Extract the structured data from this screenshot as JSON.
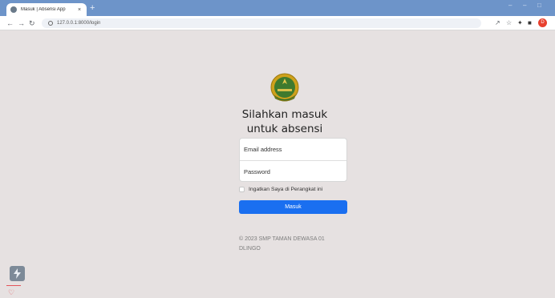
{
  "browser": {
    "tab_title": "Masuk | Absensi App",
    "tab_close": "×",
    "new_tab": "+",
    "url": "127.0.0.1:8000/login",
    "profile_initial": "D"
  },
  "login": {
    "heading_line1": "Silahkan masuk",
    "heading_line2": "untuk absensi",
    "email_placeholder": "Email address",
    "password_placeholder": "Password",
    "remember_label": "Ingatkan Saya di Perangkat ini",
    "submit_label": "Masuk",
    "footer_line1": "© 2023 SMP TAMAN DEWASA 01",
    "footer_line2": "DLINGO"
  },
  "colors": {
    "page_bg": "#e6e1e1",
    "primary_button": "#1a6ff0",
    "tab_strip": "#6d94c9"
  },
  "icons": [
    "globe-icon",
    "back-arrow-icon",
    "forward-arrow-icon",
    "reload-icon",
    "info-icon",
    "share-icon",
    "star-icon",
    "extensions-icon",
    "sidebar-icon",
    "school-logo-icon",
    "checkbox-icon",
    "lightning-icon",
    "heart-icon"
  ]
}
